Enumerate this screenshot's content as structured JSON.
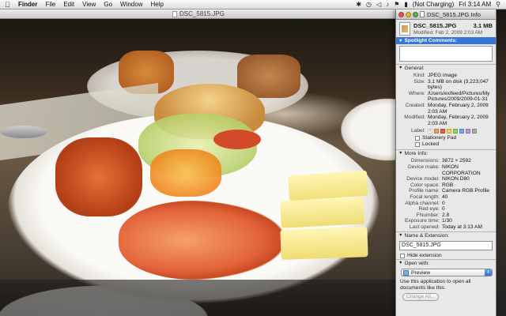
{
  "menubar": {
    "apple_icon": "apple-icon",
    "app_name": "Finder",
    "menus": [
      "File",
      "Edit",
      "View",
      "Go",
      "Window",
      "Help"
    ],
    "status": {
      "battery_text": "(Not Charging)",
      "clock": "Fri 3:14 AM",
      "icons": [
        "bluetooth-icon",
        "time-machine-icon",
        "wifi-icon",
        "volume-icon",
        "flag-icon",
        "battery-icon",
        "spotlight-icon"
      ]
    }
  },
  "preview_window": {
    "title": "DSC_5815.JPG"
  },
  "info_window": {
    "title": "DSC_5815.JPG Info",
    "file_name": "DSC_5815.JPG",
    "file_size": "3.1 MB",
    "modified_short": "Modified: Feb 2, 2009 2:03 AM",
    "spotlight_label": "Spotlight Comments:",
    "general_label": "General:",
    "general": [
      {
        "k": "Kind:",
        "v": "JPEG image"
      },
      {
        "k": "Size:",
        "v": "3.1 MB on disk (3,223,047 bytes)"
      },
      {
        "k": "Where:",
        "v": "/Users/exifeed/Pictures/My Pictures/2009/2009-01-31"
      },
      {
        "k": "Created:",
        "v": "Monday, February 2, 2009 2:03 AM"
      },
      {
        "k": "Modified:",
        "v": "Monday, February 2, 2009 2:03 AM"
      }
    ],
    "label_text": "Label:",
    "label_colors": [
      "#f39a5a",
      "#e8564e",
      "#f3d34a",
      "#8fd163",
      "#6fa8e8",
      "#c18ee0",
      "#aaaaaa"
    ],
    "stationery": "Stationery Pad",
    "locked": "Locked",
    "more_label": "More Info:",
    "more": [
      {
        "k": "Dimensions:",
        "v": "3872 × 2592"
      },
      {
        "k": "Device make:",
        "v": "NIKON CORPORATION"
      },
      {
        "k": "Device model:",
        "v": "NIKON D80"
      },
      {
        "k": "Color space:",
        "v": "RGB"
      },
      {
        "k": "Profile name:",
        "v": "Camera RGB Profile"
      },
      {
        "k": "Focal length:",
        "v": "40"
      },
      {
        "k": "Alpha channel:",
        "v": "0"
      },
      {
        "k": "Red eye:",
        "v": "0"
      },
      {
        "k": "FNumber:",
        "v": "2.8"
      },
      {
        "k": "Exposure time:",
        "v": "1/30"
      },
      {
        "k": "Last opened:",
        "v": "Today at 3:13 AM"
      }
    ],
    "name_ext_label": "Name & Extension:",
    "name_value": "DSC_5815.JPG",
    "hide_extension": "Hide extension",
    "open_with_label": "Open with:",
    "open_with_app": "Preview",
    "open_with_note": "Use this application to open all documents like this.",
    "change_all": "Change All..."
  }
}
